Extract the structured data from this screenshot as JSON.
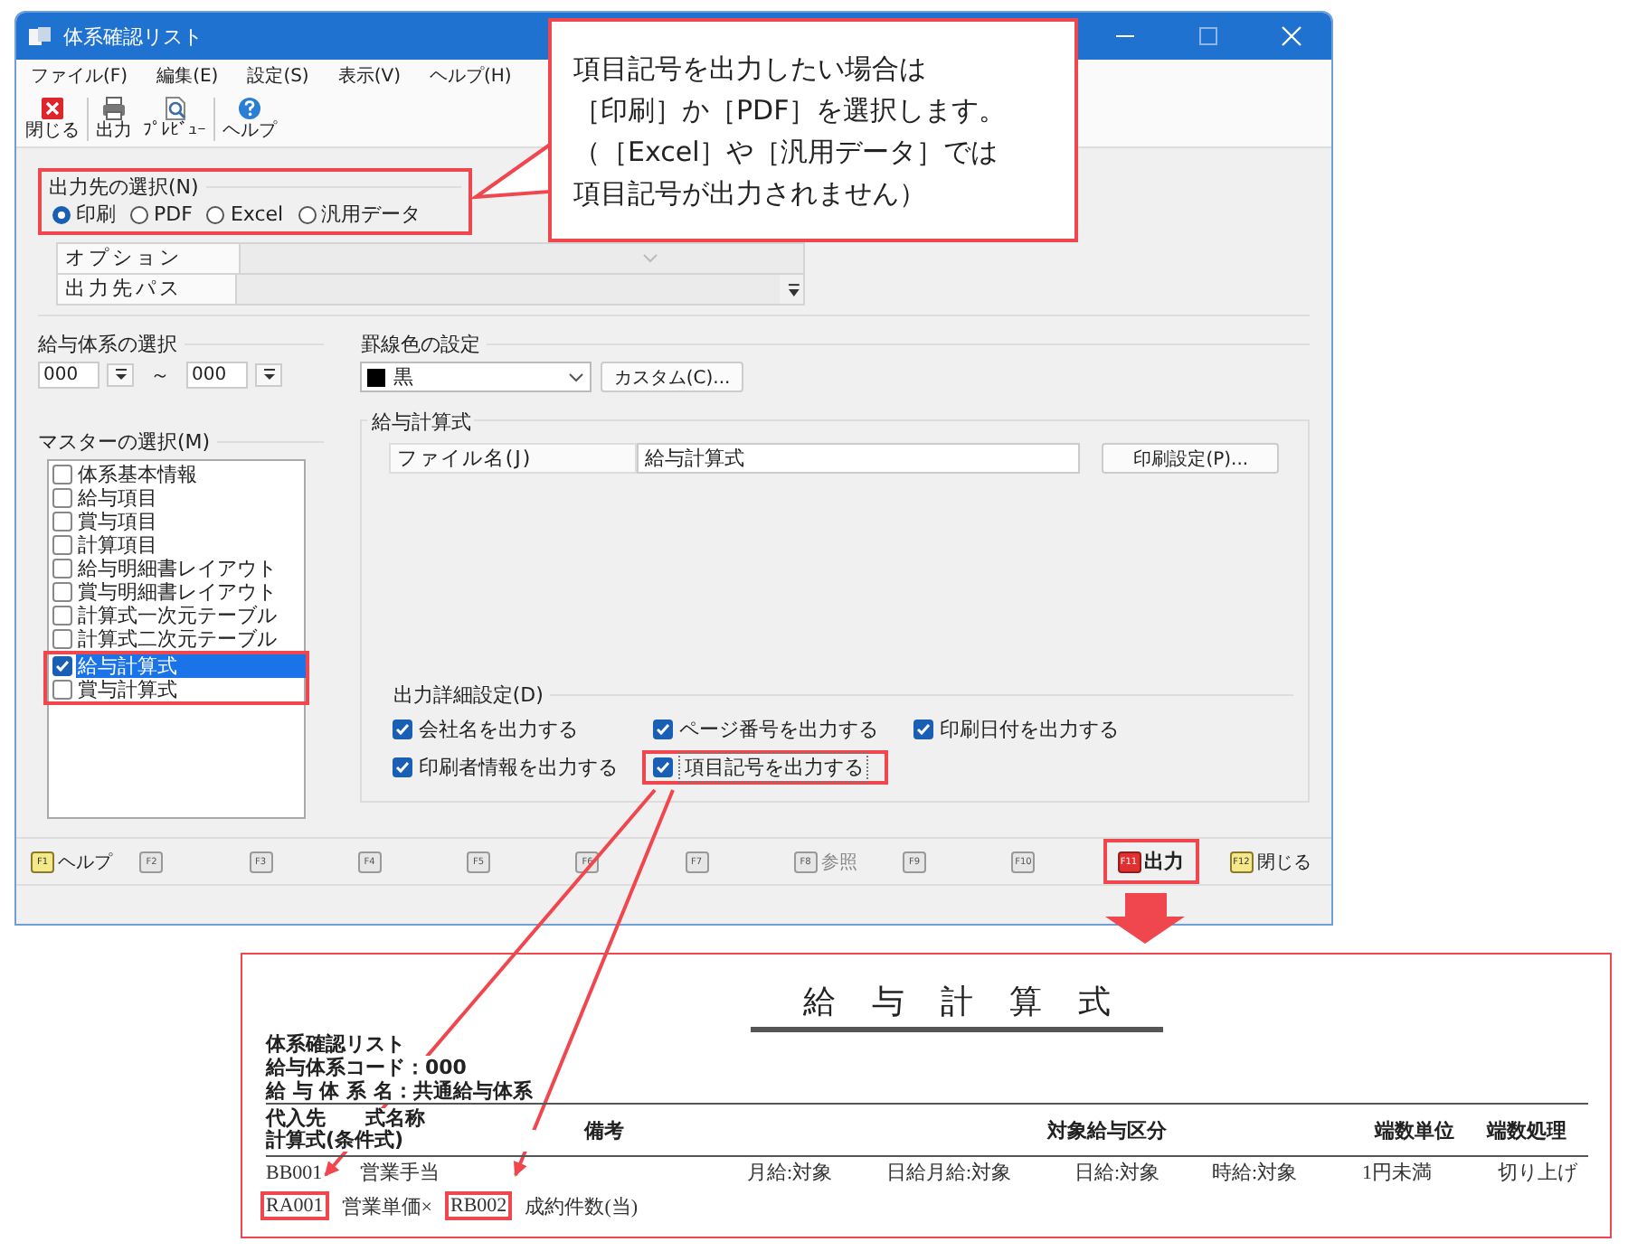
{
  "window": {
    "title": "体系確認リスト"
  },
  "menu": [
    {
      "label": "ファイル(F)"
    },
    {
      "label": "編集(E)"
    },
    {
      "label": "設定(S)"
    },
    {
      "label": "表示(V)"
    },
    {
      "label": "ヘルプ(H)"
    }
  ],
  "toolbar": [
    {
      "kind": "close",
      "label": "閉じる"
    },
    {
      "kind": "print",
      "label": "出力"
    },
    {
      "kind": "preview",
      "label": "ﾌﾟﾚﾋﾞｭｰ"
    },
    {
      "kind": "help",
      "label": "ヘルプ"
    }
  ],
  "output_destination": {
    "label": "出力先の選択(N)",
    "highlighted": true,
    "options": [
      {
        "label": "印刷",
        "selected": true
      },
      {
        "label": "PDF",
        "selected": false
      },
      {
        "label": "Excel",
        "selected": false
      },
      {
        "label": "汎用データ",
        "selected": false
      }
    ]
  },
  "output_options": [
    {
      "label": "オプション",
      "kind": "dropdown",
      "disabled": true
    },
    {
      "label": "出力先パス",
      "kind": "browse",
      "disabled": true
    }
  ],
  "salary_system": {
    "label": "給与体系の選択",
    "from": "000",
    "separator": "～",
    "to": "000"
  },
  "ruled_line_color": {
    "label": "罫線色の設定",
    "value": "黒",
    "custom_button": "カスタム(C)..."
  },
  "master": {
    "label": "マスターの選択(M)",
    "items": [
      {
        "label": "体系基本情報",
        "checked": false,
        "selected": false,
        "highlighted": false
      },
      {
        "label": "給与項目",
        "checked": false,
        "selected": false,
        "highlighted": false
      },
      {
        "label": "賞与項目",
        "checked": false,
        "selected": false,
        "highlighted": false
      },
      {
        "label": "計算項目",
        "checked": false,
        "selected": false,
        "highlighted": false
      },
      {
        "label": "給与明細書レイアウト",
        "checked": false,
        "selected": false,
        "highlighted": false
      },
      {
        "label": "賞与明細書レイアウト",
        "checked": false,
        "selected": false,
        "highlighted": false
      },
      {
        "label": "計算式一次元テーブル",
        "checked": false,
        "selected": false,
        "highlighted": false
      },
      {
        "label": "計算式二次元テーブル",
        "checked": false,
        "selected": false,
        "highlighted": false
      },
      {
        "label": "給与計算式",
        "checked": true,
        "selected": true,
        "highlighted": true
      },
      {
        "label": "賞与計算式",
        "checked": false,
        "selected": false,
        "highlighted": true
      }
    ]
  },
  "formula": {
    "label": "給与計算式",
    "file_label": "ファイル名(J)",
    "file_value": "給与計算式",
    "print_settings_button": "印刷設定(P)..."
  },
  "output_details": {
    "label": "出力詳細設定(D)",
    "options": [
      {
        "label": "会社名を出力する",
        "checked": true,
        "highlighted": false
      },
      {
        "label": "ページ番号を出力する",
        "checked": true,
        "highlighted": false
      },
      {
        "label": "印刷日付を出力する",
        "checked": true,
        "highlighted": false
      },
      {
        "label": "印刷者情報を出力する",
        "checked": true,
        "highlighted": false
      },
      {
        "label": "項目記号を出力する",
        "checked": true,
        "highlighted": true
      }
    ]
  },
  "function_keys": [
    {
      "key": "F1",
      "label": "ヘルプ",
      "kind": "active",
      "highlighted": false
    },
    {
      "key": "F2",
      "kind": "disabled",
      "highlighted": false
    },
    {
      "key": "F3",
      "kind": "disabled",
      "highlighted": false
    },
    {
      "key": "F4",
      "kind": "disabled",
      "highlighted": false
    },
    {
      "key": "F5",
      "kind": "disabled",
      "highlighted": false
    },
    {
      "key": "F6",
      "kind": "disabled",
      "highlighted": false
    },
    {
      "key": "F7",
      "kind": "disabled",
      "highlighted": false
    },
    {
      "key": "F8",
      "label": "参照",
      "kind": "disabled",
      "highlighted": false
    },
    {
      "key": "F9",
      "kind": "disabled",
      "highlighted": false
    },
    {
      "key": "F10",
      "kind": "disabled",
      "highlighted": false
    },
    {
      "key": "F11",
      "label": "出力",
      "kind": "primary",
      "highlighted": true
    },
    {
      "key": "F12",
      "label": "閉じる",
      "kind": "active",
      "highlighted": false
    }
  ],
  "callout": {
    "lines": [
      "項目記号を出力したい場合は",
      "［印刷］か［PDF］を選択します。",
      "（［Excel］や［汎用データ］では",
      "項目記号が出力されません）"
    ]
  },
  "report": {
    "title": "給与計算式",
    "info": [
      "体系確認リスト",
      "給与体系コード：000",
      "給 与 体 系 名：共通給与体系"
    ],
    "header": {
      "assign": "代入先",
      "name": "式名称",
      "formula": "計算式(条件式)",
      "columns": [
        "備考",
        "対象給与区分",
        "端数単位",
        "端数処理"
      ]
    },
    "rows": [
      {
        "cells": [
          "BB001",
          "営業手当",
          "月給:対象",
          "日給月給:対象",
          "日給:対象",
          "時給:対象",
          "1円未満",
          "切り上げ"
        ]
      }
    ],
    "formula": [
      {
        "text": "RA001",
        "highlighted": true
      },
      {
        "text": "営業単価×",
        "highlighted": false
      },
      {
        "text": "RB002",
        "highlighted": true
      },
      {
        "text": "成約件数(当)",
        "highlighted": false
      }
    ]
  }
}
